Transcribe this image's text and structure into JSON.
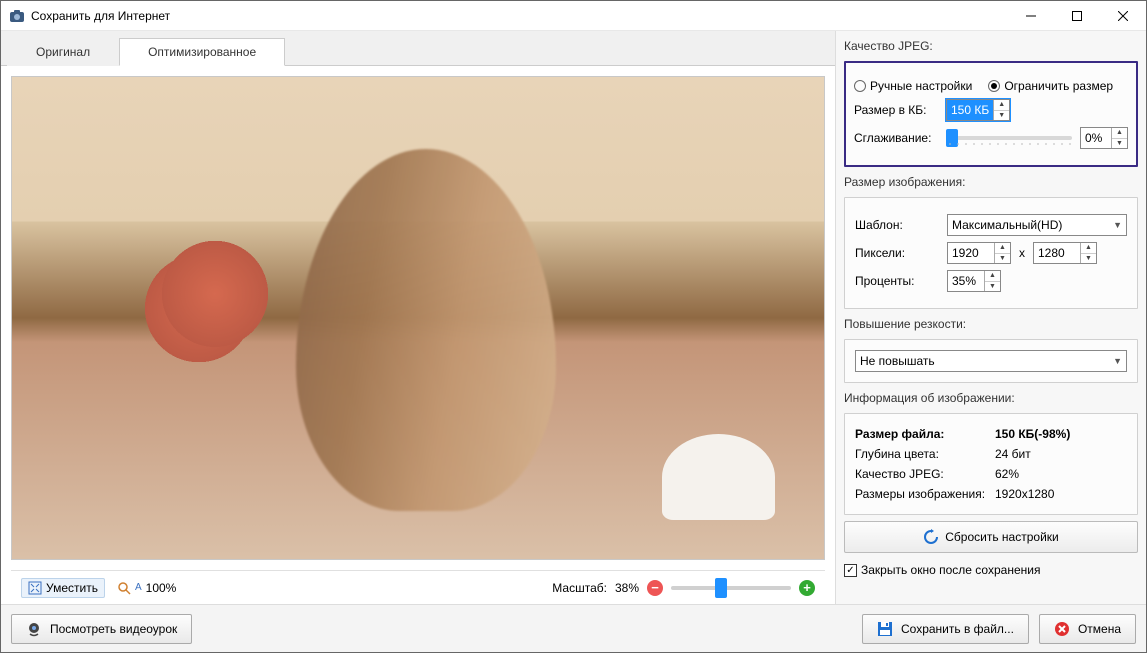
{
  "window": {
    "title": "Сохранить для Интернет"
  },
  "tabs": {
    "original": "Оригинал",
    "optimized": "Оптимизированное",
    "active": "optimized"
  },
  "zoomBar": {
    "fitLabel": "Уместить",
    "oneToOne": "100%",
    "scaleLabel": "Масштаб:",
    "scaleValue": "38%"
  },
  "quality": {
    "sectionLabel": "Качество JPEG:",
    "radioManual": "Ручные настройки",
    "radioLimit": "Ограничить размер",
    "radioSelected": "limit",
    "sizeLabel": "Размер в КБ:",
    "sizeValue": "150 КБ",
    "smoothLabel": "Сглаживание:",
    "smoothValue": "0%"
  },
  "imageSize": {
    "sectionLabel": "Размер изображения:",
    "templateLabel": "Шаблон:",
    "templateValue": "Максимальный(HD)",
    "pixelsLabel": "Пиксели:",
    "widthValue": "1920",
    "heightValue": "1280",
    "xLabel": "x",
    "percentLabel": "Проценты:",
    "percentValue": "35%"
  },
  "sharpen": {
    "sectionLabel": "Повышение резкости:",
    "value": "Не повышать"
  },
  "info": {
    "sectionLabel": "Информация об изображении:",
    "fileSizeLabel": "Размер файла:",
    "fileSizeValue": "150 КБ(-98%)",
    "depthLabel": "Глубина цвета:",
    "depthValue": "24 бит",
    "jpegQualityLabel": "Качество JPEG:",
    "jpegQualityValue": "62%",
    "dimsLabel": "Размеры изображения:",
    "dimsValue": "1920x1280"
  },
  "resetBtn": "Сбросить настройки",
  "closeAfterSave": "Закрыть окно после сохранения",
  "bottom": {
    "videoLesson": "Посмотреть видеоурок",
    "saveToFile": "Сохранить в файл...",
    "cancel": "Отмена"
  }
}
